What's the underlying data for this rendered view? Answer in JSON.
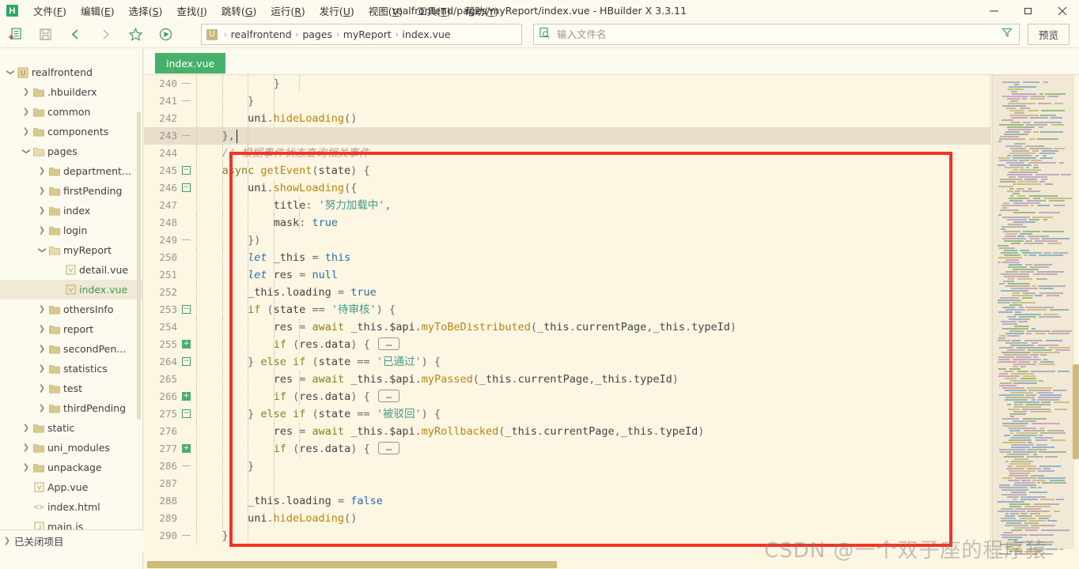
{
  "window": {
    "title": "realfrontend/pages/myReport/index.vue - HBuilder X 3.3.11",
    "logo": "H",
    "minimize": "minimize-icon",
    "maximize": "maximize-icon",
    "close": "close-icon"
  },
  "menu": [
    {
      "label": "文件(F)",
      "mnemonic": "F"
    },
    {
      "label": "编辑(E)",
      "mnemonic": "E"
    },
    {
      "label": "选择(S)",
      "mnemonic": "S"
    },
    {
      "label": "查找(I)",
      "mnemonic": "I"
    },
    {
      "label": "跳转(G)",
      "mnemonic": "G"
    },
    {
      "label": "运行(R)",
      "mnemonic": "R"
    },
    {
      "label": "发行(U)",
      "mnemonic": "U"
    },
    {
      "label": "视图(V)",
      "mnemonic": "V"
    },
    {
      "label": "工具(T)",
      "mnemonic": "T"
    },
    {
      "label": "帮助(Y)",
      "mnemonic": "Y"
    }
  ],
  "toolbar": {
    "icons": [
      "new-file-icon",
      "save-icon",
      "back-icon",
      "forward-icon",
      "star-icon",
      "run-icon"
    ],
    "breadcrumb": {
      "logo": "U",
      "parts": [
        "realfrontend",
        "pages",
        "myReport",
        "index.vue"
      ],
      "separator": "›"
    },
    "filename_placeholder": "输入文件名",
    "filename_value": "",
    "filter_icon": "filter-icon",
    "search_icon": "file-search-icon",
    "preview_label": "预览"
  },
  "sidebar": {
    "tree": [
      {
        "label": "realfrontend",
        "depth": 0,
        "arrow": "down",
        "icon": "project-icon"
      },
      {
        "label": ".hbuilderx",
        "depth": 1,
        "arrow": "right",
        "icon": "folder-icon"
      },
      {
        "label": "common",
        "depth": 1,
        "arrow": "right",
        "icon": "folder-icon"
      },
      {
        "label": "components",
        "depth": 1,
        "arrow": "right",
        "icon": "folder-icon"
      },
      {
        "label": "pages",
        "depth": 1,
        "arrow": "down",
        "icon": "folder-open-icon"
      },
      {
        "label": "department...",
        "depth": 2,
        "arrow": "right",
        "icon": "folder-icon"
      },
      {
        "label": "firstPending",
        "depth": 2,
        "arrow": "right",
        "icon": "folder-icon"
      },
      {
        "label": "index",
        "depth": 2,
        "arrow": "right",
        "icon": "folder-icon"
      },
      {
        "label": "login",
        "depth": 2,
        "arrow": "right",
        "icon": "folder-icon"
      },
      {
        "label": "myReport",
        "depth": 2,
        "arrow": "down",
        "icon": "folder-open-icon"
      },
      {
        "label": "detail.vue",
        "depth": 3,
        "arrow": "none",
        "icon": "vue-file-icon"
      },
      {
        "label": "index.vue",
        "depth": 3,
        "arrow": "none",
        "icon": "vue-file-icon",
        "selected": true,
        "active": true
      },
      {
        "label": "othersInfo",
        "depth": 2,
        "arrow": "right",
        "icon": "folder-icon"
      },
      {
        "label": "report",
        "depth": 2,
        "arrow": "right",
        "icon": "folder-icon"
      },
      {
        "label": "secondPen...",
        "depth": 2,
        "arrow": "right",
        "icon": "folder-icon"
      },
      {
        "label": "statistics",
        "depth": 2,
        "arrow": "right",
        "icon": "folder-icon"
      },
      {
        "label": "test",
        "depth": 2,
        "arrow": "right",
        "icon": "folder-icon"
      },
      {
        "label": "thirdPending",
        "depth": 2,
        "arrow": "right",
        "icon": "folder-icon"
      },
      {
        "label": "static",
        "depth": 1,
        "arrow": "right",
        "icon": "folder-icon"
      },
      {
        "label": "uni_modules",
        "depth": 1,
        "arrow": "right",
        "icon": "folder-icon"
      },
      {
        "label": "unpackage",
        "depth": 1,
        "arrow": "right",
        "icon": "folder-icon"
      },
      {
        "label": "App.vue",
        "depth": 1,
        "arrow": "none",
        "icon": "vue-file-icon"
      },
      {
        "label": "index.html",
        "depth": 1,
        "arrow": "none",
        "icon": "html-file-icon"
      },
      {
        "label": "main.js",
        "depth": 1,
        "arrow": "none",
        "icon": "js-file-icon"
      }
    ],
    "closed_projects": "已关闭项目"
  },
  "editor": {
    "tabs": [
      {
        "label": "index.vue",
        "active": true
      }
    ],
    "current_line": 243,
    "lines": [
      {
        "num": 240,
        "fold": "dash",
        "indent": 5,
        "text": "            }"
      },
      {
        "num": 241,
        "fold": "dash",
        "indent": 4,
        "text": "        }"
      },
      {
        "num": 242,
        "fold": "none",
        "indent": 4,
        "text": "        uni.hideLoading()"
      },
      {
        "num": 243,
        "fold": "dash",
        "indent": 3,
        "text": "    },",
        "highlight": true
      },
      {
        "num": 244,
        "fold": "none",
        "indent": 3,
        "text": "    // 根据事件状态查询相关事件"
      },
      {
        "num": 245,
        "fold": "minus",
        "indent": 3,
        "text": "    async getEvent(state) {"
      },
      {
        "num": 246,
        "fold": "minus",
        "indent": 4,
        "text": "        uni.showLoading({"
      },
      {
        "num": 247,
        "fold": "none",
        "indent": 5,
        "text": "            title: '努力加载中',"
      },
      {
        "num": 248,
        "fold": "none",
        "indent": 5,
        "text": "            mask: true"
      },
      {
        "num": 249,
        "fold": "dash",
        "indent": 4,
        "text": "        })"
      },
      {
        "num": 250,
        "fold": "none",
        "indent": 4,
        "text": "        let _this = this"
      },
      {
        "num": 251,
        "fold": "none",
        "indent": 4,
        "text": "        let res = null"
      },
      {
        "num": 252,
        "fold": "none",
        "indent": 4,
        "text": "        _this.loading = true"
      },
      {
        "num": 253,
        "fold": "minus",
        "indent": 4,
        "text": "        if (state == '待审核') {"
      },
      {
        "num": 254,
        "fold": "none",
        "indent": 5,
        "text": "            res = await _this.$api.myToBeDistributed(_this.currentPage,_this.typeId)"
      },
      {
        "num": 255,
        "fold": "plus",
        "indent": 5,
        "text": "            if (res.data) { … "
      },
      {
        "num": 264,
        "fold": "minus",
        "indent": 4,
        "text": "        } else if (state == '已通过') {"
      },
      {
        "num": 265,
        "fold": "none",
        "indent": 5,
        "text": "            res = await _this.$api.myPassed(_this.currentPage,_this.typeId)"
      },
      {
        "num": 266,
        "fold": "plus",
        "indent": 5,
        "text": "            if (res.data) { … "
      },
      {
        "num": 275,
        "fold": "minus",
        "indent": 4,
        "text": "        } else if (state == '被驳回') {"
      },
      {
        "num": 276,
        "fold": "none",
        "indent": 5,
        "text": "            res = await _this.$api.myRollbacked(_this.currentPage,_this.typeId)"
      },
      {
        "num": 277,
        "fold": "plus",
        "indent": 5,
        "text": "            if (res.data) { … "
      },
      {
        "num": 286,
        "fold": "dash",
        "indent": 4,
        "text": "        }"
      },
      {
        "num": 287,
        "fold": "none",
        "indent": 4,
        "text": ""
      },
      {
        "num": 288,
        "fold": "none",
        "indent": 4,
        "text": "        _this.loading = false"
      },
      {
        "num": 289,
        "fold": "none",
        "indent": 4,
        "text": "        uni.hideLoading()"
      },
      {
        "num": 290,
        "fold": "dash",
        "indent": 3,
        "text": "    },"
      }
    ],
    "ellipsis_label": "…"
  },
  "annotation": {
    "color": "#f53228",
    "shape": "rectangle"
  },
  "watermark": "CSDN @一个双子座的程序猿",
  "colors": {
    "background": "#fdf6e3",
    "panel": "#fdfaf0",
    "accent_green": "#47b16b",
    "keyword": "#8a7f1e",
    "string": "#3f9a8c",
    "comment": "#a8a296",
    "function": "#b8860b",
    "highlight_line": "#e7decb",
    "scrollbar": "#cdb97a"
  }
}
